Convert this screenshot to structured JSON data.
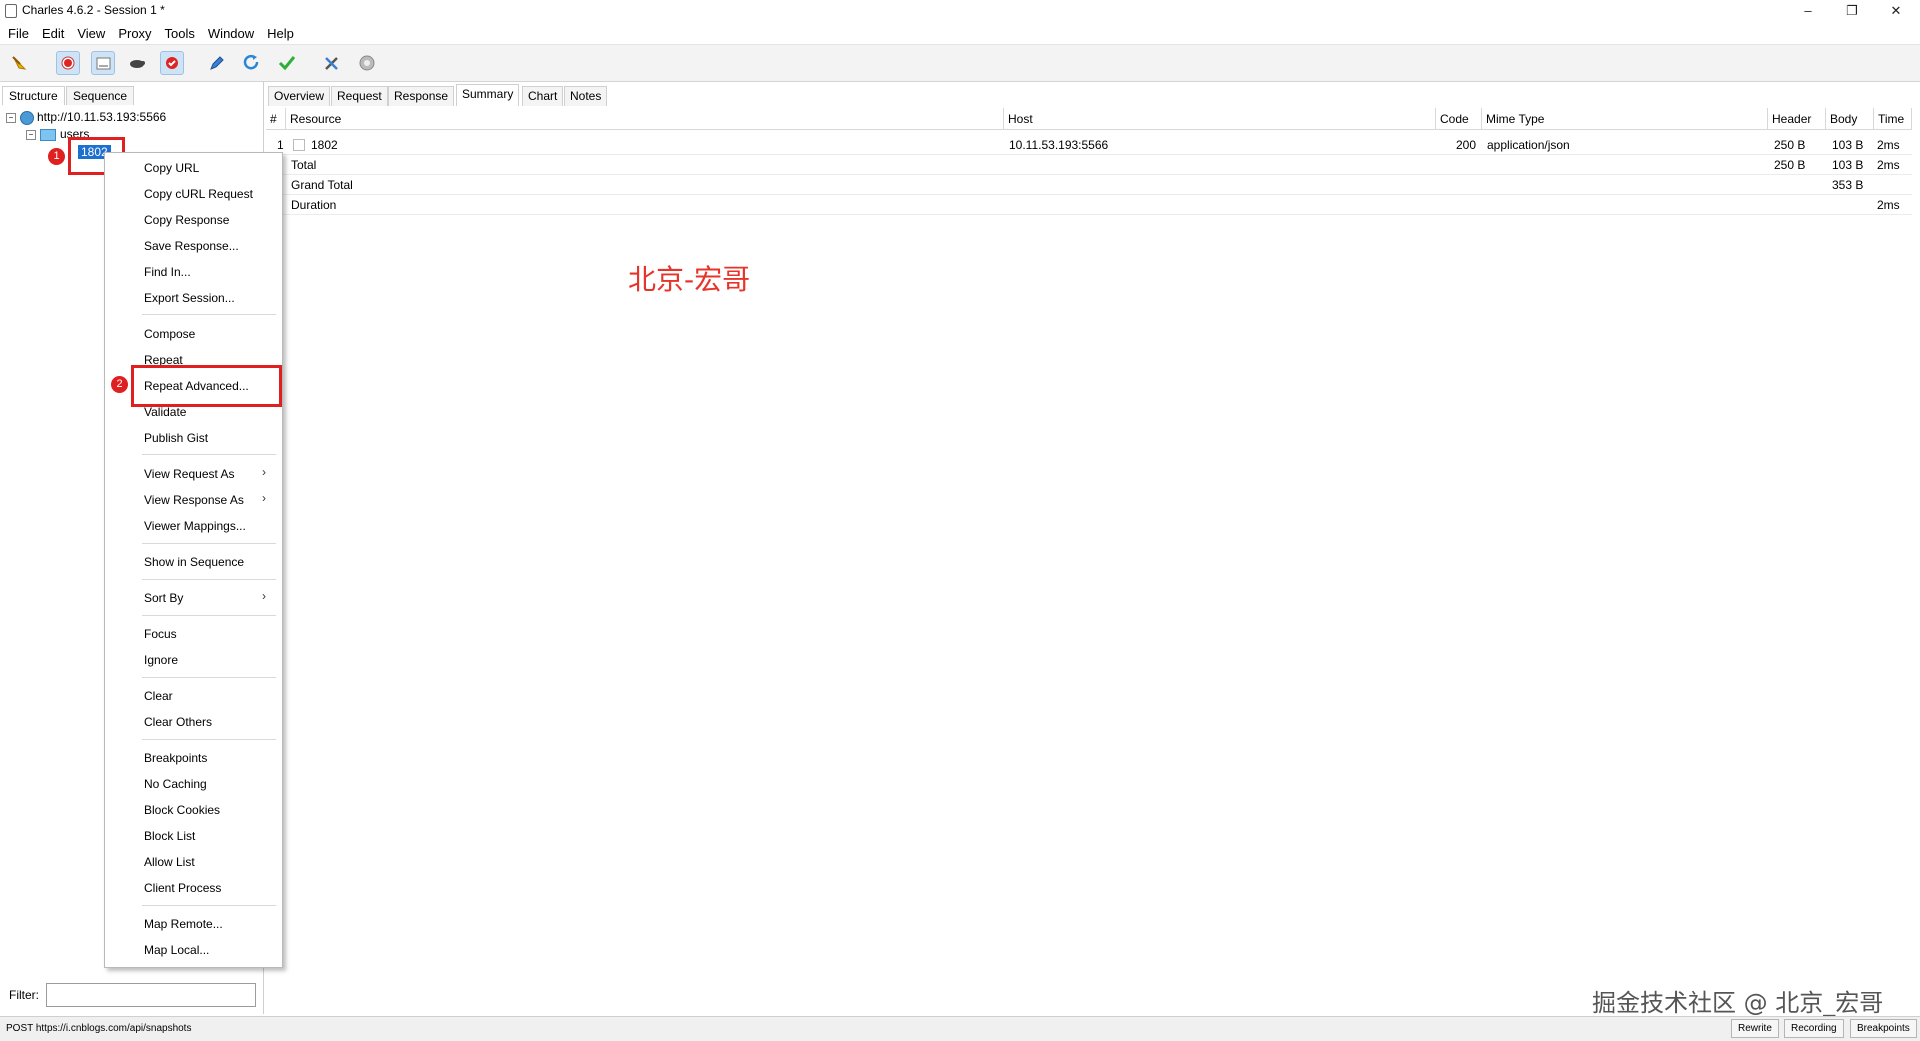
{
  "window": {
    "title": "Charles 4.6.2 - Session 1 *",
    "controls": [
      "minimize-icon",
      "restore-icon",
      "close-icon"
    ]
  },
  "menubar": [
    "File",
    "Edit",
    "View",
    "Proxy",
    "Tools",
    "Window",
    "Help"
  ],
  "toolbar": {
    "icons": [
      "broom-icon",
      "record-icon",
      "throttle-icon",
      "turtle-icon",
      "breakpoint-icon",
      "pen-icon",
      "refresh-icon",
      "check-icon",
      "tools-icon",
      "settings-icon"
    ]
  },
  "left_tabs": [
    "Structure",
    "Sequence"
  ],
  "tree": {
    "host": "http://10.11.53.193:5566",
    "folder": "users",
    "selected": "1802"
  },
  "badges": {
    "one": "1",
    "two": "2"
  },
  "filter": {
    "label": "Filter:",
    "value": ""
  },
  "right_tabs": [
    "Overview",
    "Request",
    "Response",
    "Summary",
    "Chart",
    "Notes"
  ],
  "table": {
    "headers": [
      "#",
      "Resource",
      "Host",
      "Code",
      "Mime Type",
      "Header",
      "Body",
      "Time"
    ],
    "rows": [
      {
        "num": "1",
        "resource": "1802",
        "host": "10.11.53.193:5566",
        "code": "200",
        "mime": "application/json",
        "header": "250 B",
        "body": "103 B",
        "time": "2ms"
      },
      {
        "num": "",
        "resource": "Total",
        "host": "",
        "code": "",
        "mime": "",
        "header": "250 B",
        "body": "103 B",
        "time": "2ms"
      },
      {
        "num": "",
        "resource": "Grand Total",
        "host": "",
        "code": "",
        "mime": "",
        "header": "",
        "body": "353 B",
        "time": ""
      },
      {
        "num": "",
        "resource": "Duration",
        "host": "",
        "code": "",
        "mime": "",
        "header": "",
        "body": "",
        "time": "2ms"
      }
    ]
  },
  "context_menu": {
    "items": [
      "Copy URL",
      "Copy cURL Request",
      "Copy Response",
      "Save Response...",
      "Find In...",
      "Export Session...",
      "Compose",
      "Repeat",
      "Repeat Advanced...",
      "Validate",
      "Publish Gist",
      "View Request As",
      "View Response As",
      "Viewer Mappings...",
      "Show in Sequence",
      "Sort By",
      "Focus",
      "Ignore",
      "Clear",
      "Clear Others",
      "Breakpoints",
      "No Caching",
      "Block Cookies",
      "Block List",
      "Allow List",
      "Client Process",
      "Map Remote...",
      "Map Local..."
    ]
  },
  "watermark_center": "北京-宏哥",
  "watermark_corner": "掘金技术社区 @ 北京_宏哥",
  "status": {
    "text": "POST https://i.cnblogs.com/api/snapshots",
    "buttons": [
      "Rewrite",
      "Recording",
      "Breakpoints"
    ]
  },
  "colors": {
    "highlight": "#e02020",
    "selection": "#1d6fd0",
    "watermark": "#e8332a"
  }
}
